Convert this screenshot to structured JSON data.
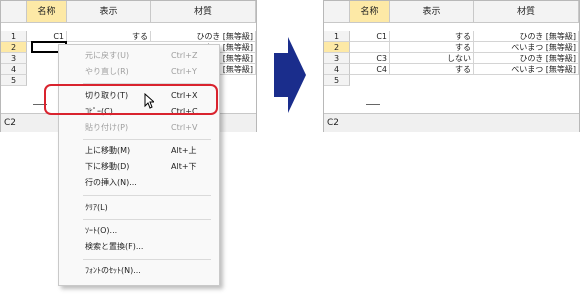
{
  "left": {
    "headers": [
      "名称",
      "表示",
      "材質"
    ],
    "rows": [
      {
        "num": "1",
        "name": "C1",
        "display": "する",
        "material": "ひのき [無等級]"
      },
      {
        "num": "2",
        "name": "",
        "display": "",
        "material": "べいまつ [無等級]"
      },
      {
        "num": "3",
        "name": "",
        "display": "",
        "material": "ひのき [無等級]"
      },
      {
        "num": "4",
        "name": "",
        "display": "",
        "material": "べいまつ [無等級]"
      },
      {
        "num": "5",
        "name": "",
        "display": "",
        "material": ""
      }
    ],
    "status": "C2"
  },
  "right": {
    "headers": [
      "名称",
      "表示",
      "材質"
    ],
    "rows": [
      {
        "num": "1",
        "name": "C1",
        "display": "する",
        "material": "ひのき [無等級]"
      },
      {
        "num": "2",
        "name": "",
        "display": "する",
        "material": "べいまつ [無等級]"
      },
      {
        "num": "3",
        "name": "C3",
        "display": "しない",
        "material": "ひのき [無等級]"
      },
      {
        "num": "4",
        "name": "C4",
        "display": "する",
        "material": "べいまつ [無等級]"
      },
      {
        "num": "5",
        "name": "",
        "display": "",
        "material": ""
      }
    ],
    "status": "C2"
  },
  "menu": {
    "items": [
      {
        "label": "元に戻す(U)",
        "shortcut": "Ctrl+Z",
        "disabled": true
      },
      {
        "label": "やり直し(R)",
        "shortcut": "Ctrl+Y",
        "disabled": true
      },
      {
        "label": "切り取り(T)",
        "shortcut": "Ctrl+X",
        "disabled": false
      },
      {
        "label": "ｺﾋﾟｰ(C)",
        "shortcut": "Ctrl+C",
        "disabled": false
      },
      {
        "label": "貼り付け(P)",
        "shortcut": "Ctrl+V",
        "disabled": true
      },
      {
        "label": "上に移動(M)",
        "shortcut": "Alt+上",
        "disabled": false
      },
      {
        "label": "下に移動(D)",
        "shortcut": "Alt+下",
        "disabled": false
      },
      {
        "label": "行の挿入(N)...",
        "shortcut": "",
        "disabled": false
      },
      {
        "label": "ｸﾘｱ(L)",
        "shortcut": "",
        "disabled": false
      },
      {
        "label": "ｿｰﾄ(O)...",
        "shortcut": "",
        "disabled": false
      },
      {
        "label": "検索と置換(F)...",
        "shortcut": "",
        "disabled": false
      },
      {
        "label": "ﾌｫﾝﾄのｾｯﾄ(N)...",
        "shortcut": "",
        "disabled": false
      }
    ]
  },
  "colors": {
    "highlight_border": "#d9232e",
    "arrow": "#1a2d8c",
    "selected_header": "#fde9a6"
  }
}
